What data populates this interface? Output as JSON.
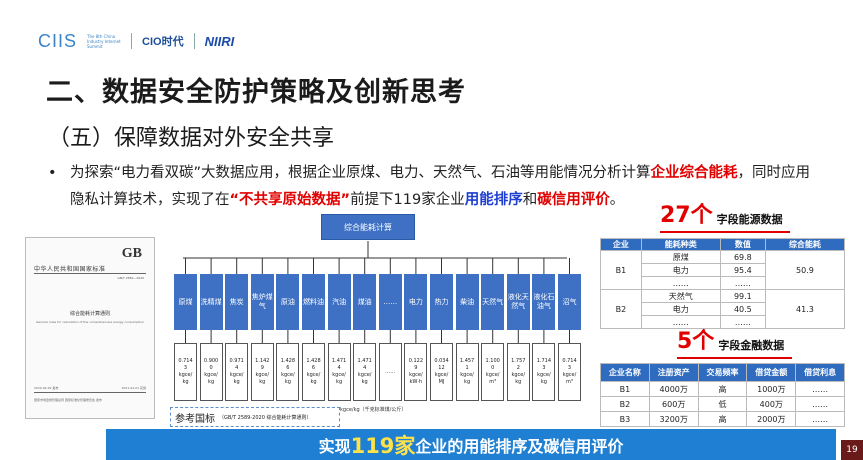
{
  "header": {
    "logo_ciis": "CIIS",
    "logo_ciis_small": "The 8th China Industry Internet Summit",
    "logo_cio": "CIO时代",
    "logo_niiri": "NIIRI"
  },
  "title": "二、数据安全防护策略及创新思考",
  "subtitle": "（五）保障数据对外安全共享",
  "bullet": {
    "dot": "•",
    "p1": "为探索“电力看双碳”大数据应用，根据企业原煤、电力、天然气、石油等用能情况分析计算",
    "r1": "企业综合能耗",
    "p2": "，同时应用隐私计算技术，实现了在",
    "r2": "“不共享原始数据”",
    "p3": "前提下119家企业",
    "b1": "用能排序",
    "p4": "和",
    "b2": "碳信用评价",
    "p5": "。"
  },
  "gb_doc": {
    "logo": "GB",
    "head": "中华人民共和国国家标准",
    "code": "GB/T 2589—2020",
    "title": "综合能耗计算通则",
    "title_en": "General rules for calculation of the comprehensive energy consumption",
    "date_left": "2020-09-29 发布",
    "date_right": "2021-04-01 实施",
    "org": "国家市场监督管理总局 国家标准化管理委员会 发布"
  },
  "chart": {
    "top": "综合能耗计算",
    "columns": [
      "原煤",
      "洗精煤",
      "焦炭",
      "焦炉煤气",
      "原油",
      "燃料油",
      "汽油",
      "煤油",
      "……",
      "电力",
      "热力",
      "柴油",
      "天然气",
      "液化天然气",
      "液化石油气",
      "沼气"
    ],
    "values": [
      "0.714\n3\nkgce/\nkg",
      "0.900\n0\nkgce/\nkg",
      "0.971\n4\nkgce/\nkg",
      "1.142\n9\nkgce/\nkg",
      "1.428\n6\nkgce/\nkg",
      "1.428\n6\nkgce/\nkg",
      "1.471\n4\nkgce/\nkg",
      "1.471\n4\nkgce/\nkg",
      "……",
      "0.122\n9\nkgce/\nkW·h",
      "0.034\n12\nkgce/\nMJ",
      "1.457\n1\nkgce/\nkg",
      "1.100\n0\nkgce/\nm³",
      "1.757\n2\nkgce/\nkg",
      "1.714\n3\nkgce/\nkg",
      "0.714\n3\nkgce/\nm³"
    ],
    "unit_note": "kgce/kg（千克标准煤/公斤）",
    "ref_label": "参考国标",
    "ref_code": "（GB/T 2589-2020 综合能耗计算通则）"
  },
  "table1": {
    "count": "27个",
    "heading": "字段能源数据",
    "headers": [
      "企业",
      "能耗种类",
      "数值",
      "综合能耗"
    ],
    "rows": [
      {
        "company": "B1",
        "kind": "原煤",
        "value": "69.8",
        "total": "50.9"
      },
      {
        "company": "",
        "kind": "电力",
        "value": "95.4",
        "total": ""
      },
      {
        "company": "",
        "kind": "……",
        "value": "……",
        "total": ""
      },
      {
        "company": "B2",
        "kind": "天然气",
        "value": "99.1",
        "total": "41.3"
      },
      {
        "company": "",
        "kind": "电力",
        "value": "40.5",
        "total": ""
      },
      {
        "company": "",
        "kind": "……",
        "value": "……",
        "total": ""
      }
    ]
  },
  "table2": {
    "count": "5个",
    "heading": "字段金融数据",
    "headers": [
      "企业名称",
      "注册资产",
      "交易频率",
      "借贷金额",
      "借贷利息"
    ],
    "rows": [
      [
        "B1",
        "4000万",
        "高",
        "1000万",
        "……"
      ],
      [
        "B2",
        "600万",
        "低",
        "400万",
        "……"
      ],
      [
        "B3",
        "3200万",
        "高",
        "2000万",
        "……"
      ]
    ]
  },
  "banner": {
    "pre": "实现",
    "big": "119家",
    "post": "企业的用能排序及碳信用评价"
  },
  "page_number": "19"
}
